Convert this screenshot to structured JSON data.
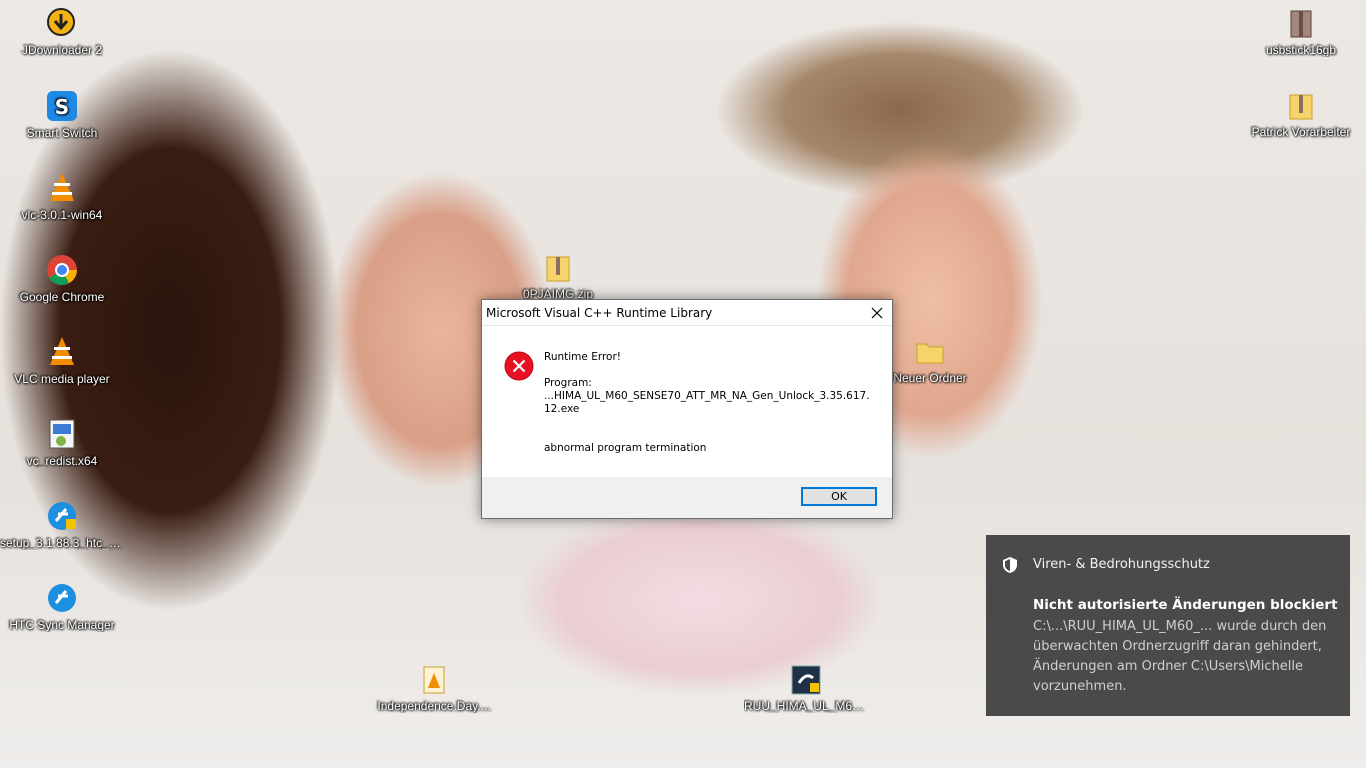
{
  "desktop": {
    "icons_left": [
      {
        "label": "JDownloader 2",
        "icon": "jdownloader-icon"
      },
      {
        "label": "Smart Switch",
        "icon": "smart-switch-icon"
      },
      {
        "label": "vlc-3.0.1-win64",
        "icon": "vlc-icon"
      },
      {
        "label": "Google Chrome",
        "icon": "chrome-icon"
      },
      {
        "label": "VLC media player",
        "icon": "vlc-icon"
      },
      {
        "label": "vc_redist.x64",
        "icon": "installer-icon"
      },
      {
        "label": "setup_3.1.88.3_htc_N...",
        "icon": "htc-setup-icon"
      },
      {
        "label": "HTC Sync Manager",
        "icon": "htc-sync-icon"
      }
    ],
    "icons_right": [
      {
        "label": "usbstick16gb",
        "icon": "archive-icon"
      },
      {
        "label": "Patrick Vorarbeiter",
        "icon": "zip-folder-icon"
      }
    ],
    "icons_middle": [
      {
        "label": "0PJAIMG.zip",
        "icon": "zip-folder-icon"
      },
      {
        "label": "Neuer Ordner",
        "icon": "folder-icon"
      },
      {
        "label": "Independence.Day....",
        "icon": "vlc-file-icon"
      },
      {
        "label": "RUU_HIMA_UL_M60...",
        "icon": "ruu-app-icon"
      }
    ]
  },
  "dialog": {
    "title": "Microsoft Visual C++ Runtime Library",
    "error_title": "Runtime Error!",
    "program_label": "Program:",
    "program_path": "...HIMA_UL_M60_SENSE70_ATT_MR_NA_Gen_Unlock_3.35.617.12.exe",
    "message": "abnormal program termination",
    "ok_label": "OK"
  },
  "toast": {
    "app_name": "Viren- & Bedrohungsschutz",
    "heading": "Nicht autorisierte Änderungen blockiert",
    "body": "C:\\...\\RUU_HIMA_UL_M60_... wurde durch den überwachten Ordnerzugriff daran gehindert, Änderungen am Ordner C:\\Users\\Michelle vorzunehmen."
  },
  "colors": {
    "toast_bg": "#4a4a4a",
    "error_red": "#e81123",
    "button_border": "#0078d7",
    "dialog_footer": "#f0f0f0"
  }
}
